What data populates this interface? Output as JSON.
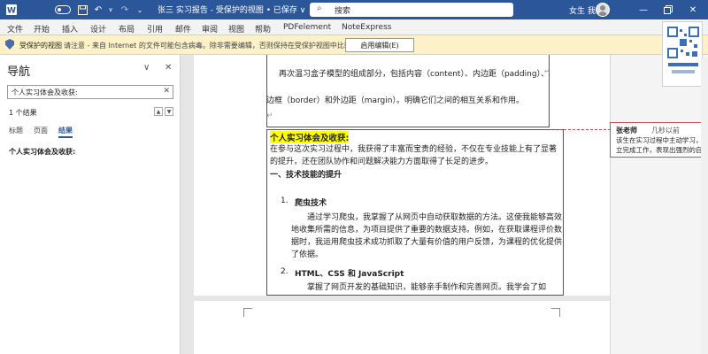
{
  "titlebar": {
    "doc_title": "张三 实习报告 - 受保护的视图 • 已保存 ∨",
    "search_text": "搜索",
    "user_name": "女生 我",
    "icons": [
      "word-icon",
      "autosave-toggle",
      "save-icon",
      "undo-icon",
      "redo-icon",
      "customize-icon",
      "search-icon",
      "avatar",
      "minimize-icon",
      "restore-icon",
      "close-icon"
    ]
  },
  "ribbon": {
    "tabs": [
      "文件",
      "开始",
      "插入",
      "设计",
      "布局",
      "引用",
      "邮件",
      "审阅",
      "视图",
      "帮助",
      "PDFelement",
      "NoteExpress"
    ]
  },
  "protected_bar": {
    "title": "受保护的视图",
    "message": "请注意 - 来自 Internet 的文件可能包含病毒。除非需要编辑，否则保持在受保护视图中比较安全。",
    "button": "启用编辑(E)"
  },
  "nav": {
    "title": "导航",
    "search_value": "个人实习体会及收获:",
    "result_count": "1 个结果",
    "tabs": [
      "标题",
      "页面",
      "结果"
    ],
    "active_tab": "结果",
    "result_item": "个人实习体会及收获:"
  },
  "document": {
    "p1": "再次温习盒子模型的组成部分，包括内容（content）、内边距（padding）、",
    "p2": "边框（border）和外边距（margin）。明确它们之间的相互关系和作用。",
    "heading": "个人实习体会及收获:",
    "intro": "在参与这次实习过程中，我获得了丰富而宝贵的经验，不仅在专业技能上有了显著的提升，还在团队协作和问题解决能力方面取得了长足的进步。",
    "section1": "一、技术技能的提升",
    "item1_num": "1.",
    "item1_title": "爬虫技术",
    "item1_body": "通过学习爬虫，我掌握了从网页中自动获取数据的方法。这使我能够高效地收集所需的信息，为项目提供了重要的数据支持。例如，在获取课程评价数据时，我运用爬虫技术成功抓取了大量有价值的用户反馈，为课程的优化提供了依据。",
    "item2_num": "2.",
    "item2_title": "HTML、CSS 和 JavaScript",
    "item2_body": "掌握了网页开发的基础知识，能够亲手制作和完善网页。我学会了如"
  },
  "comment": {
    "author": "张老师",
    "time": "几秒以前",
    "body_line1": "该生在实习过程中主动学习，快速",
    "body_line2": "立完成工作，表现出强烈的自我提"
  },
  "colors": {
    "titlebar": "#2b579a",
    "highlight": "#ffff00",
    "protected_bar": "#fdf1c9",
    "comment_border": "#c0504d"
  }
}
